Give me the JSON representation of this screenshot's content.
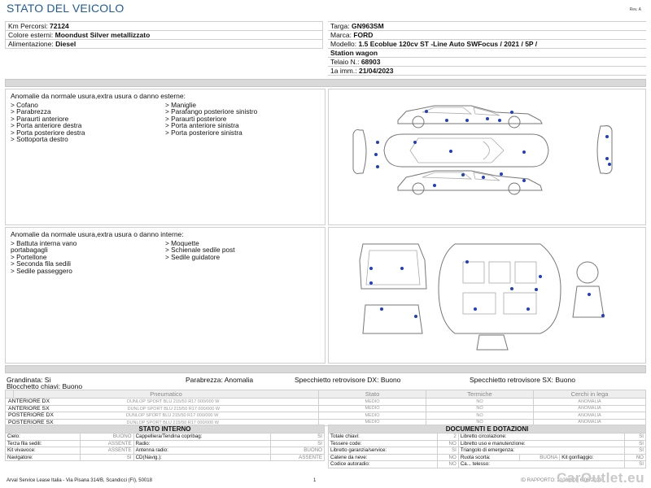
{
  "header": {
    "title": "STATO DEL VEICOLO",
    "rev": "Rev. A"
  },
  "vehicle_left": [
    {
      "label": "Km Percorsi:",
      "value": "72124"
    },
    {
      "label": "Colore esterni:",
      "value": "Moondust Silver metallizzato"
    },
    {
      "label": "Alimentazione:",
      "value": "Diesel"
    }
  ],
  "vehicle_right": {
    "targa": {
      "label": "Targa:",
      "value": "GN963SM"
    },
    "marca": {
      "label": "Marca:",
      "value": "FORD"
    },
    "modello": {
      "label": "Modello:",
      "value": "1.5 Ecoblue 120cv ST -Line Auto SWFocus / 2021 / 5P /"
    },
    "modello_2": "Station wagon",
    "telaio": {
      "label": "Telaio N.:",
      "value": "68903"
    },
    "imm": {
      "label": "1a imm.:",
      "value": "21/04/2023"
    }
  },
  "external_damage": {
    "title": "Anomalie da normale usura,extra usura o danno esterne:",
    "col1": [
      "> Cofano",
      "> Parabrezza",
      "> Paraurti anteriore",
      "> Porta anteriore destra",
      "> Porta posteriore destra",
      "> Sottoporta destro"
    ],
    "col2": [
      "> Maniglie",
      "> Parafango posteriore sinistro",
      "> Paraurti posteriore",
      "> Porta anteriore sinistra",
      "> Porta posteriore sinistra"
    ]
  },
  "internal_damage": {
    "title": "Anomalie da normale usura,extra usura o danno interne:",
    "col1": [
      "> Battuta interna vano",
      "portabagagli",
      "> Portellone",
      "> Seconda fila sedili",
      "> Sedile passeggero"
    ],
    "col2": [
      "> Moquette",
      "> Schienale sedile post",
      "> Sedile guidatore"
    ]
  },
  "summary": {
    "grandinata": "Grandinata: Si",
    "parabrezza": "Parabrezza: Anomalia",
    "specchietto_dx": "Specchietto retrovisore DX: Buono",
    "specchietto_sx": "Specchietto retrovisore SX: Buono",
    "blocchetto": "Blocchetto chiavi: Buono"
  },
  "tyres": {
    "headers": [
      "Pneumatico",
      "Stato",
      "Termiche",
      "Cerchi in lega"
    ],
    "rows": [
      {
        "pos": "ANTERIORE DX",
        "tyre": "DUNLOP SPORT BLU  215/50 R17 000/000 W",
        "stato": "MEDIO",
        "termiche": "NO",
        "cerchi": "ANOMALIA"
      },
      {
        "pos": "ANTERIORE SX",
        "tyre": "DUNLOP SPORT BLU  215/50 R17 000/000 W",
        "stato": "MEDIO",
        "termiche": "NO",
        "cerchi": "ANOMALIA"
      },
      {
        "pos": "POSTERIORE DX",
        "tyre": "DUNLOP SPORT BLU  215/50 R17 000/000 W",
        "stato": "MEDIO",
        "termiche": "NO",
        "cerchi": "ANOMALIA"
      },
      {
        "pos": "POSTERIORE SX",
        "tyre": "DUNLOP SPORT BLU  215/50 R17 000/000 W",
        "stato": "MEDIO",
        "termiche": "NO",
        "cerchi": "ANOMALIA"
      }
    ]
  },
  "stato_interno": {
    "title": "STATO INTERNO",
    "rows": [
      [
        "Cielo:",
        "BUONO",
        "Cappelliera/Tendina copribag:",
        "SI"
      ],
      [
        "Terza fila sedili:",
        "ASSENTE",
        "Radio:",
        "SI"
      ],
      [
        "Kit vivavoce:",
        "ASSENTE",
        "Antenna radio:",
        "BUONO"
      ],
      [
        "Navigatore:",
        "SI",
        "CD(Navig.):",
        "ASSENTE"
      ]
    ]
  },
  "documenti": {
    "title": "DOCUMENTI E DOTAZIONI",
    "rows": [
      [
        "Totale chiavi:",
        "2",
        "Libretto circolazione:",
        "SI"
      ],
      [
        "Tessere code:",
        "NO",
        "Libretto uso e manutenzione:",
        "SI"
      ],
      [
        "Libretto garanzia/service:",
        "SI",
        "Triangolo di emergenza:",
        "SI"
      ],
      [
        "Catene da neve:",
        "NO",
        "Ruota scorta:",
        "BUONA",
        "Kit gonfiaggio:",
        "NO"
      ],
      [
        "Codice autoradio:",
        "NO",
        "Ca... telesso:",
        "SI"
      ]
    ]
  },
  "footer": {
    "company": "Arval Service Lease Italia - Via Pisana 314/B, Scandicci (FI), 50018",
    "page": "1",
    "ref": "ID RAPPORTO: 2108850 | 6/06/2023",
    "watermark": "CarOutlet.eu"
  }
}
